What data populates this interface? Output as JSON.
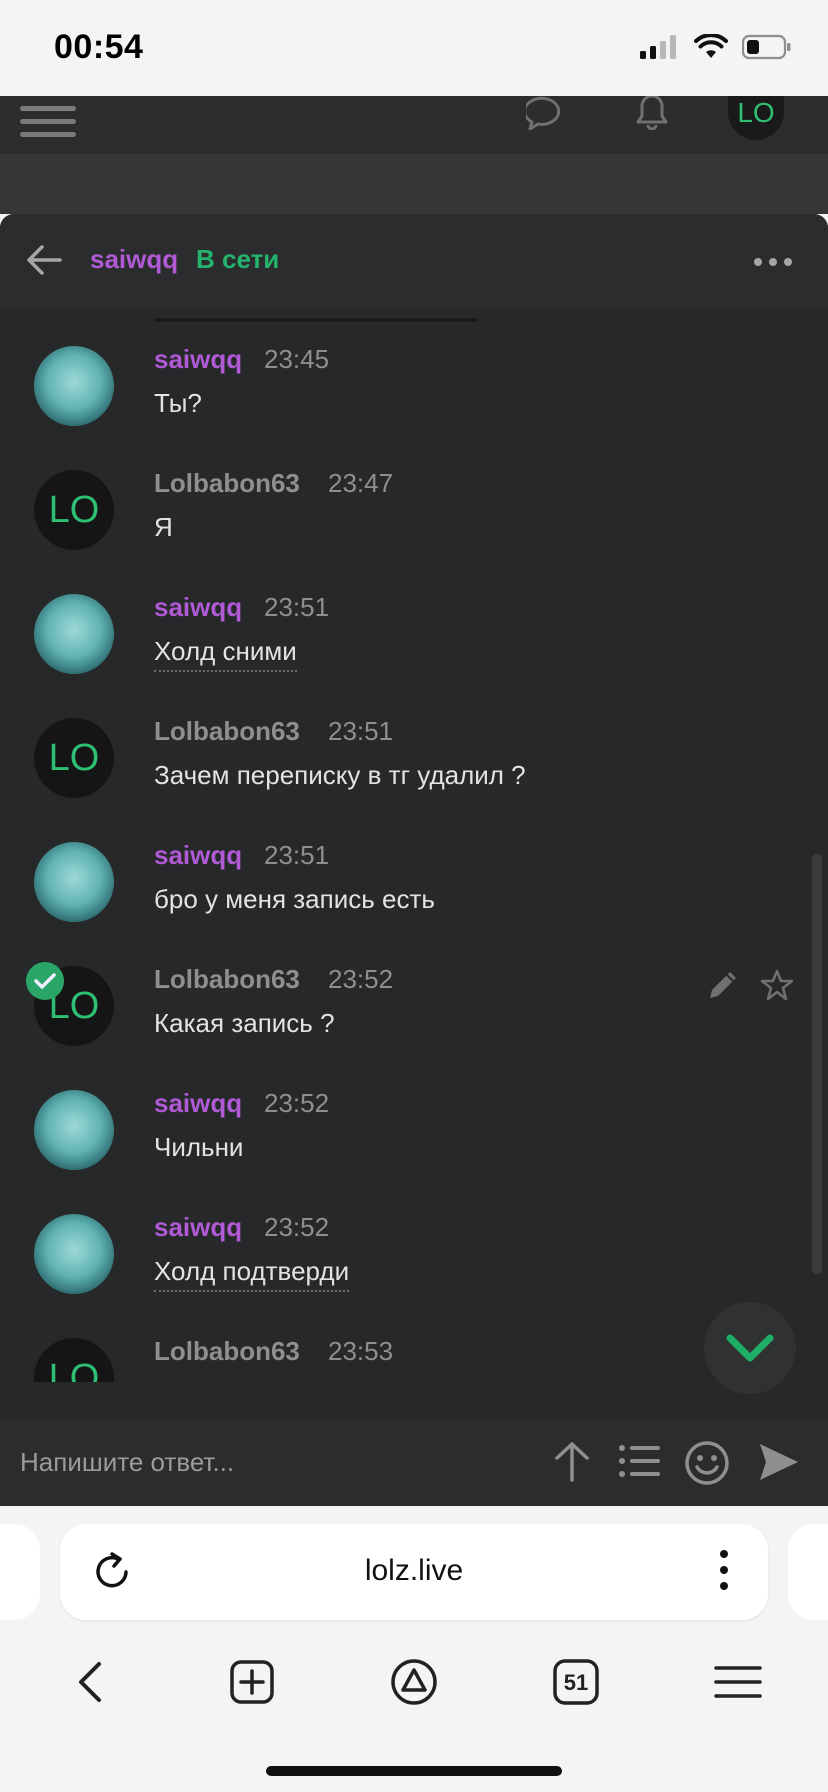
{
  "status_bar": {
    "time": "00:54"
  },
  "site_header": {
    "avatar_initials": "LO",
    "icons": [
      "menu-icon",
      "chat-bubble-icon",
      "bell-icon"
    ]
  },
  "chat": {
    "username": "saiwqq",
    "status": "В сети",
    "messages": [
      {
        "author": "saiwqq",
        "author_color": "#b05ad6",
        "time": "23:45",
        "text": "Ты?",
        "avatar": "miku",
        "underlined": false
      },
      {
        "author": "Lolbabon63",
        "author_color": "#8e8f91",
        "time": "23:47",
        "text": "Я",
        "avatar": "LO",
        "underlined": false
      },
      {
        "author": "saiwqq",
        "author_color": "#b05ad6",
        "time": "23:51",
        "text": "Холд сними",
        "avatar": "miku",
        "underlined": true
      },
      {
        "author": "Lolbabon63",
        "author_color": "#8e8f91",
        "time": "23:51",
        "text": "Зачем переписку в тг удалил ?",
        "avatar": "LO",
        "underlined": false
      },
      {
        "author": "saiwqq",
        "author_color": "#b05ad6",
        "time": "23:51",
        "text": "бро у меня запись есть",
        "avatar": "miku",
        "underlined": false
      },
      {
        "author": "Lolbabon63",
        "author_color": "#8e8f91",
        "time": "23:52",
        "text": "Какая запись ?",
        "avatar": "LO",
        "underlined": false,
        "selected": true
      },
      {
        "author": "saiwqq",
        "author_color": "#b05ad6",
        "time": "23:52",
        "text": "Чильни",
        "avatar": "miku",
        "underlined": false
      },
      {
        "author": "saiwqq",
        "author_color": "#b05ad6",
        "time": "23:52",
        "text": "Холд подтверди",
        "avatar": "miku",
        "underlined": true
      },
      {
        "author": "Lolbabon63",
        "author_color": "#8e8f91",
        "time": "23:53",
        "text": "",
        "avatar": "LO",
        "underlined": false
      }
    ],
    "composer_placeholder": "Напишите ответ..."
  },
  "browser": {
    "url": "lolz.live",
    "tab_count": "51"
  },
  "colors": {
    "accent_purple": "#b05ad6",
    "online_green": "#24b26c",
    "panel_bg": "#272829"
  }
}
